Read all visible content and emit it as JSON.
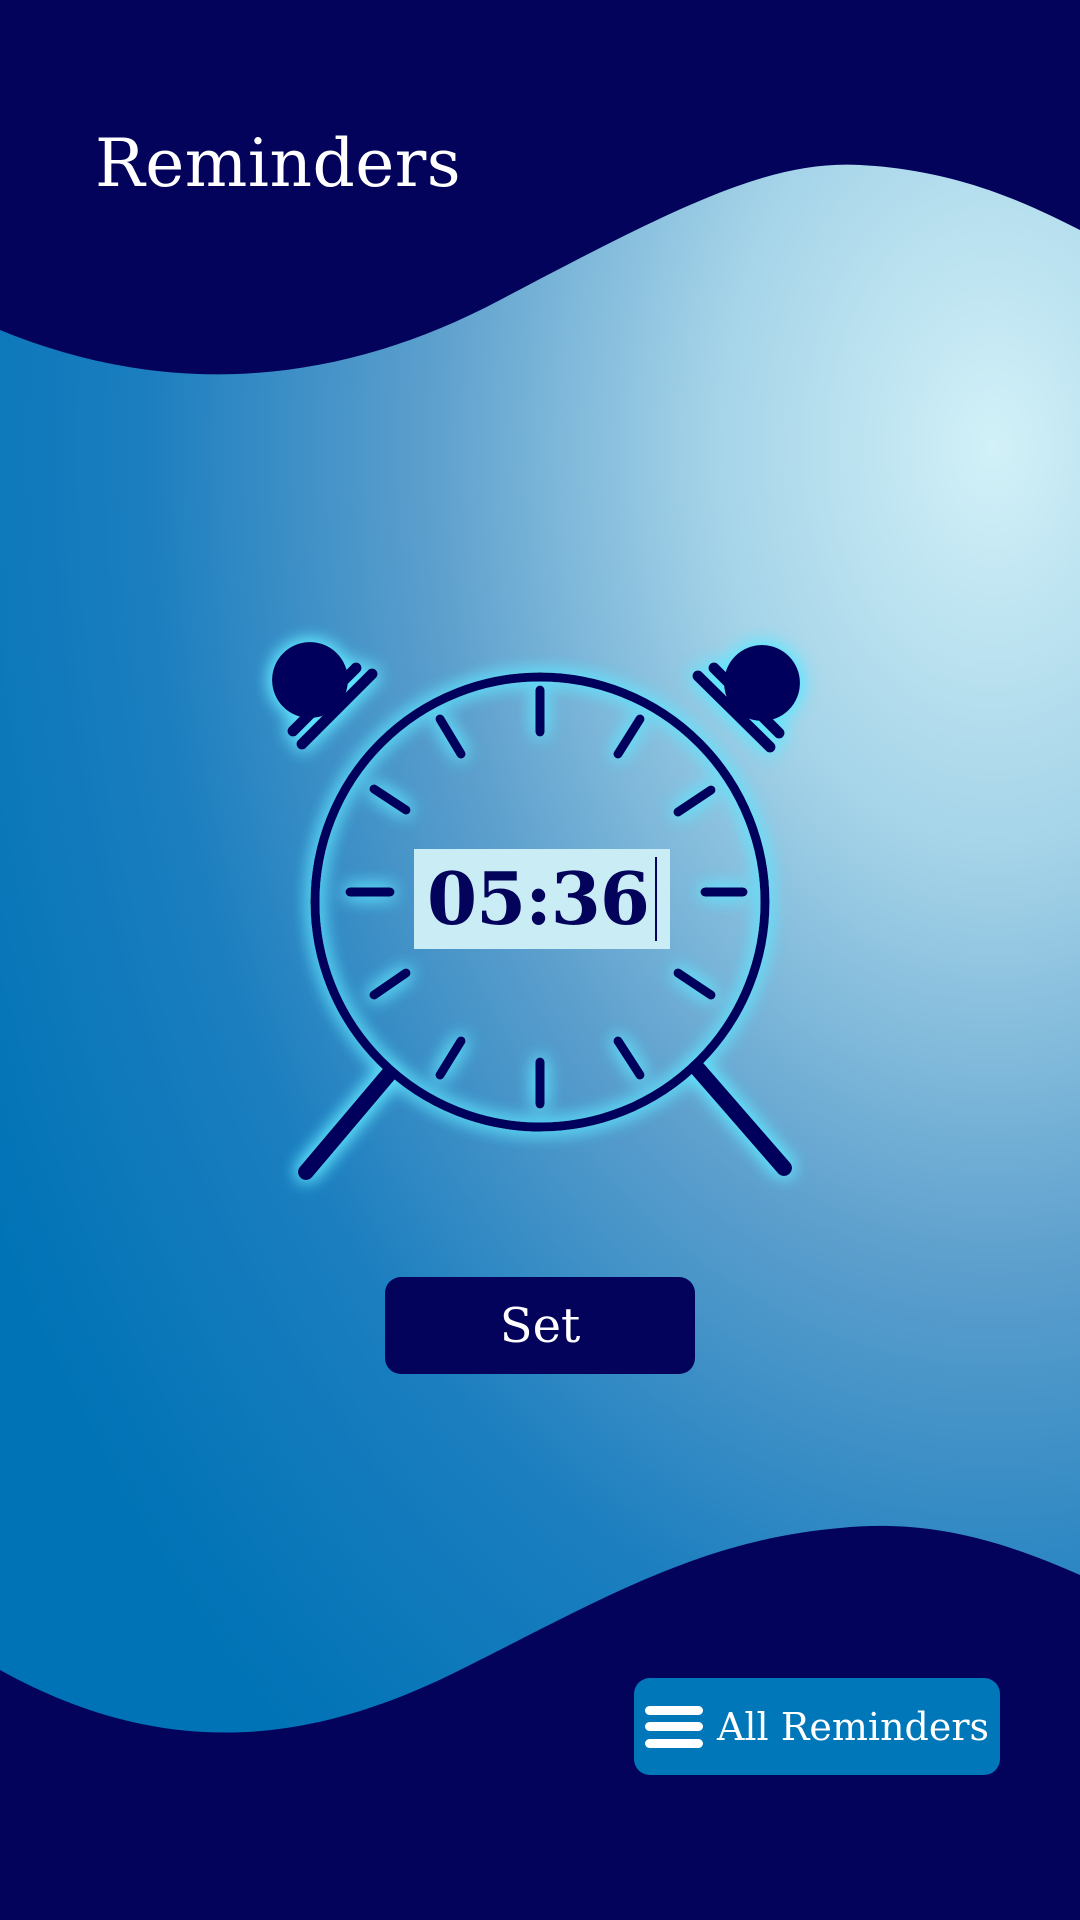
{
  "app": {
    "title": "Reminders"
  },
  "timer": {
    "value": "05:36"
  },
  "actions": {
    "set_label": "Set",
    "all_reminders_label": "All Reminders"
  },
  "icons": {
    "clock": "alarm-clock-icon",
    "menu": "menu-icon"
  },
  "colors": {
    "navy": "#03035c",
    "accent_blue": "#0077b8",
    "light_cyan": "#c9ecf5",
    "glow": "#5fe6ff"
  }
}
